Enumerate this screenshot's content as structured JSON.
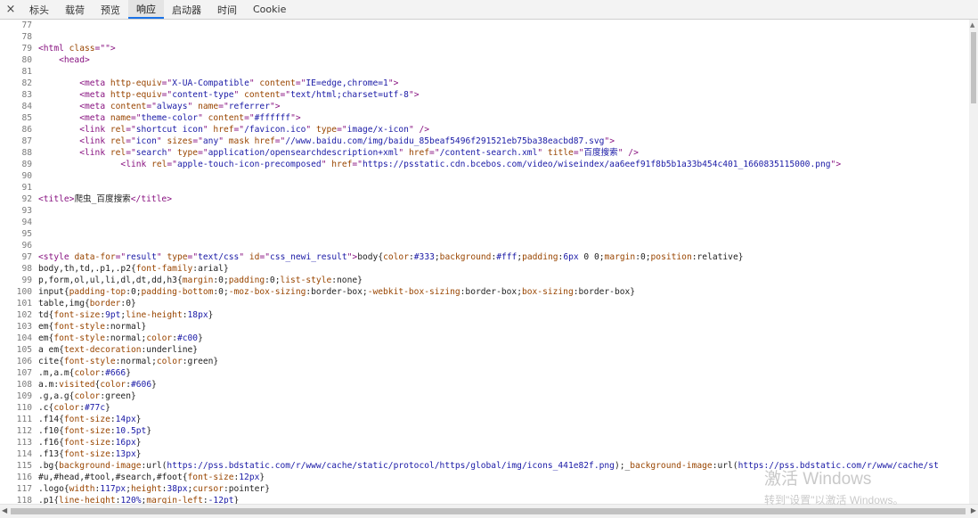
{
  "tabs": {
    "close": "×",
    "items": [
      "标头",
      "载荷",
      "预览",
      "响应",
      "启动器",
      "时间",
      "Cookie"
    ],
    "active_index": 3
  },
  "source_lines": [
    {
      "n": "77",
      "segs": []
    },
    {
      "n": "78",
      "segs": []
    },
    {
      "n": "79",
      "segs": [
        [
          "tg",
          "<html "
        ],
        [
          "at",
          "class"
        ],
        [
          "tg",
          "=\""
        ],
        [
          "av",
          ""
        ],
        [
          "tg",
          "\">"
        ]
      ]
    },
    {
      "n": "80",
      "segs": [
        [
          "tx",
          "    "
        ],
        [
          "tg",
          "<head>"
        ]
      ]
    },
    {
      "n": "81",
      "segs": []
    },
    {
      "n": "82",
      "segs": [
        [
          "tx",
          "        "
        ],
        [
          "tg",
          "<meta "
        ],
        [
          "at",
          "http-equiv"
        ],
        [
          "tg",
          "=\""
        ],
        [
          "av",
          "X-UA-Compatible"
        ],
        [
          "tg",
          "\" "
        ],
        [
          "at",
          "content"
        ],
        [
          "tg",
          "=\""
        ],
        [
          "av",
          "IE=edge,chrome=1"
        ],
        [
          "tg",
          "\">"
        ]
      ]
    },
    {
      "n": "83",
      "segs": [
        [
          "tx",
          "        "
        ],
        [
          "tg",
          "<meta "
        ],
        [
          "at",
          "http-equiv"
        ],
        [
          "tg",
          "=\""
        ],
        [
          "av",
          "content-type"
        ],
        [
          "tg",
          "\" "
        ],
        [
          "at",
          "content"
        ],
        [
          "tg",
          "=\""
        ],
        [
          "av",
          "text/html;charset=utf-8"
        ],
        [
          "tg",
          "\">"
        ]
      ]
    },
    {
      "n": "84",
      "segs": [
        [
          "tx",
          "        "
        ],
        [
          "tg",
          "<meta "
        ],
        [
          "at",
          "content"
        ],
        [
          "tg",
          "=\""
        ],
        [
          "av",
          "always"
        ],
        [
          "tg",
          "\" "
        ],
        [
          "at",
          "name"
        ],
        [
          "tg",
          "=\""
        ],
        [
          "av",
          "referrer"
        ],
        [
          "tg",
          "\">"
        ]
      ]
    },
    {
      "n": "85",
      "segs": [
        [
          "tx",
          "        "
        ],
        [
          "tg",
          "<meta "
        ],
        [
          "at",
          "name"
        ],
        [
          "tg",
          "=\""
        ],
        [
          "av",
          "theme-color"
        ],
        [
          "tg",
          "\" "
        ],
        [
          "at",
          "content"
        ],
        [
          "tg",
          "=\""
        ],
        [
          "av",
          "#ffffff"
        ],
        [
          "tg",
          "\">"
        ]
      ]
    },
    {
      "n": "86",
      "segs": [
        [
          "tx",
          "        "
        ],
        [
          "tg",
          "<link "
        ],
        [
          "at",
          "rel"
        ],
        [
          "tg",
          "=\""
        ],
        [
          "av",
          "shortcut icon"
        ],
        [
          "tg",
          "\" "
        ],
        [
          "at",
          "href"
        ],
        [
          "tg",
          "=\""
        ],
        [
          "av",
          "/favicon.ico"
        ],
        [
          "tg",
          "\" "
        ],
        [
          "at",
          "type"
        ],
        [
          "tg",
          "=\""
        ],
        [
          "av",
          "image/x-icon"
        ],
        [
          "tg",
          "\" />"
        ]
      ]
    },
    {
      "n": "87",
      "segs": [
        [
          "tx",
          "        "
        ],
        [
          "tg",
          "<link "
        ],
        [
          "at",
          "rel"
        ],
        [
          "tg",
          "=\""
        ],
        [
          "av",
          "icon"
        ],
        [
          "tg",
          "\" "
        ],
        [
          "at",
          "sizes"
        ],
        [
          "tg",
          "=\""
        ],
        [
          "av",
          "any"
        ],
        [
          "tg",
          "\" "
        ],
        [
          "at",
          "mask href"
        ],
        [
          "tg",
          "=\""
        ],
        [
          "av",
          "//www.baidu.com/img/baidu_85beaf5496f291521eb75ba38eacbd87.svg"
        ],
        [
          "tg",
          "\">"
        ]
      ]
    },
    {
      "n": "88",
      "segs": [
        [
          "tx",
          "        "
        ],
        [
          "tg",
          "<link "
        ],
        [
          "at",
          "rel"
        ],
        [
          "tg",
          "=\""
        ],
        [
          "av",
          "search"
        ],
        [
          "tg",
          "\" "
        ],
        [
          "at",
          "type"
        ],
        [
          "tg",
          "=\""
        ],
        [
          "av",
          "application/opensearchdescription+xml"
        ],
        [
          "tg",
          "\" "
        ],
        [
          "at",
          "href"
        ],
        [
          "tg",
          "=\""
        ],
        [
          "av",
          "/content-search.xml"
        ],
        [
          "tg",
          "\" "
        ],
        [
          "at",
          "title"
        ],
        [
          "tg",
          "=\""
        ],
        [
          "av",
          "百度搜索"
        ],
        [
          "tg",
          "\" />"
        ]
      ]
    },
    {
      "n": "89",
      "segs": [
        [
          "tx",
          "                "
        ],
        [
          "tg",
          "<link "
        ],
        [
          "at",
          "rel"
        ],
        [
          "tg",
          "=\""
        ],
        [
          "av",
          "apple-touch-icon-precomposed"
        ],
        [
          "tg",
          "\" "
        ],
        [
          "at",
          "href"
        ],
        [
          "tg",
          "=\""
        ],
        [
          "av",
          "https://psstatic.cdn.bcebos.com/video/wiseindex/aa6eef91f8b5b1a33b454c401_1660835115000.png"
        ],
        [
          "tg",
          "\">"
        ]
      ]
    },
    {
      "n": "90",
      "segs": []
    },
    {
      "n": "91",
      "segs": []
    },
    {
      "n": "92",
      "segs": [
        [
          "tg",
          "<title>"
        ],
        [
          "tx",
          "爬虫_百度搜索"
        ],
        [
          "tg",
          "</title>"
        ]
      ]
    },
    {
      "n": "93",
      "segs": []
    },
    {
      "n": "94",
      "segs": []
    },
    {
      "n": "95",
      "segs": []
    },
    {
      "n": "96",
      "segs": []
    },
    {
      "n": "97",
      "segs": [
        [
          "tg",
          "<style "
        ],
        [
          "at",
          "data-for"
        ],
        [
          "tg",
          "=\""
        ],
        [
          "av",
          "result"
        ],
        [
          "tg",
          "\" "
        ],
        [
          "at",
          "type"
        ],
        [
          "tg",
          "=\""
        ],
        [
          "av",
          "text/css"
        ],
        [
          "tg",
          "\" "
        ],
        [
          "at",
          "id"
        ],
        [
          "tg",
          "=\""
        ],
        [
          "av",
          "css_newi_result"
        ],
        [
          "tg",
          "\">"
        ],
        [
          "tx",
          "body{"
        ],
        [
          "at",
          "color"
        ],
        [
          "tx",
          ":"
        ],
        [
          "av",
          "#333"
        ],
        [
          "tx",
          ";"
        ],
        [
          "at",
          "background"
        ],
        [
          "tx",
          ":"
        ],
        [
          "av",
          "#fff"
        ],
        [
          "tx",
          ";"
        ],
        [
          "at",
          "padding"
        ],
        [
          "tx",
          ":"
        ],
        [
          "av",
          "6px"
        ],
        [
          "tx",
          " 0 0;"
        ],
        [
          "at",
          "margin"
        ],
        [
          "tx",
          ":0;"
        ],
        [
          "at",
          "position"
        ],
        [
          "tx",
          ":relative}"
        ]
      ]
    },
    {
      "n": "98",
      "segs": [
        [
          "tx",
          "body,th,td,.p1,.p2{"
        ],
        [
          "at",
          "font-family"
        ],
        [
          "tx",
          ":arial}"
        ]
      ]
    },
    {
      "n": "99",
      "segs": [
        [
          "tx",
          "p,form,ol,ul,li,dl,dt,dd,h3{"
        ],
        [
          "at",
          "margin"
        ],
        [
          "tx",
          ":0;"
        ],
        [
          "at",
          "padding"
        ],
        [
          "tx",
          ":0;"
        ],
        [
          "at",
          "list-style"
        ],
        [
          "tx",
          ":none}"
        ]
      ]
    },
    {
      "n": "100",
      "segs": [
        [
          "tx",
          "input{"
        ],
        [
          "at",
          "padding-top"
        ],
        [
          "tx",
          ":0;"
        ],
        [
          "at",
          "padding-bottom"
        ],
        [
          "tx",
          ":0;"
        ],
        [
          "at",
          "-moz-box-sizing"
        ],
        [
          "tx",
          ":border-box;"
        ],
        [
          "at",
          "-webkit-box-sizing"
        ],
        [
          "tx",
          ":border-box;"
        ],
        [
          "at",
          "box-sizing"
        ],
        [
          "tx",
          ":border-box}"
        ]
      ]
    },
    {
      "n": "101",
      "segs": [
        [
          "tx",
          "table,img{"
        ],
        [
          "at",
          "border"
        ],
        [
          "tx",
          ":0}"
        ]
      ]
    },
    {
      "n": "102",
      "segs": [
        [
          "tx",
          "td{"
        ],
        [
          "at",
          "font-size"
        ],
        [
          "tx",
          ":"
        ],
        [
          "av",
          "9pt"
        ],
        [
          "tx",
          ";"
        ],
        [
          "at",
          "line-height"
        ],
        [
          "tx",
          ":"
        ],
        [
          "av",
          "18px"
        ],
        [
          "tx",
          "}"
        ]
      ]
    },
    {
      "n": "103",
      "segs": [
        [
          "tx",
          "em{"
        ],
        [
          "at",
          "font-style"
        ],
        [
          "tx",
          ":normal}"
        ]
      ]
    },
    {
      "n": "104",
      "segs": [
        [
          "tx",
          "em{"
        ],
        [
          "at",
          "font-style"
        ],
        [
          "tx",
          ":normal;"
        ],
        [
          "at",
          "color"
        ],
        [
          "tx",
          ":"
        ],
        [
          "av",
          "#c00"
        ],
        [
          "tx",
          "}"
        ]
      ]
    },
    {
      "n": "105",
      "segs": [
        [
          "tx",
          "a em{"
        ],
        [
          "at",
          "text-decoration"
        ],
        [
          "tx",
          ":underline}"
        ]
      ]
    },
    {
      "n": "106",
      "segs": [
        [
          "tx",
          "cite{"
        ],
        [
          "at",
          "font-style"
        ],
        [
          "tx",
          ":normal;"
        ],
        [
          "at",
          "color"
        ],
        [
          "tx",
          ":green}"
        ]
      ]
    },
    {
      "n": "107",
      "segs": [
        [
          "tx",
          ".m,a.m{"
        ],
        [
          "at",
          "color"
        ],
        [
          "tx",
          ":"
        ],
        [
          "av",
          "#666"
        ],
        [
          "tx",
          "}"
        ]
      ]
    },
    {
      "n": "108",
      "segs": [
        [
          "tx",
          "a.m:"
        ],
        [
          "at",
          "visited"
        ],
        [
          "tx",
          "{"
        ],
        [
          "at",
          "color"
        ],
        [
          "tx",
          ":"
        ],
        [
          "av",
          "#606"
        ],
        [
          "tx",
          "}"
        ]
      ]
    },
    {
      "n": "109",
      "segs": [
        [
          "tx",
          ".g,a.g{"
        ],
        [
          "at",
          "color"
        ],
        [
          "tx",
          ":green}"
        ]
      ]
    },
    {
      "n": "110",
      "segs": [
        [
          "tx",
          ".c{"
        ],
        [
          "at",
          "color"
        ],
        [
          "tx",
          ":"
        ],
        [
          "av",
          "#77c"
        ],
        [
          "tx",
          "}"
        ]
      ]
    },
    {
      "n": "111",
      "segs": [
        [
          "tx",
          ".f14{"
        ],
        [
          "at",
          "font-size"
        ],
        [
          "tx",
          ":"
        ],
        [
          "av",
          "14px"
        ],
        [
          "tx",
          "}"
        ]
      ]
    },
    {
      "n": "112",
      "segs": [
        [
          "tx",
          ".f10{"
        ],
        [
          "at",
          "font-size"
        ],
        [
          "tx",
          ":"
        ],
        [
          "av",
          "10.5pt"
        ],
        [
          "tx",
          "}"
        ]
      ]
    },
    {
      "n": "113",
      "segs": [
        [
          "tx",
          ".f16{"
        ],
        [
          "at",
          "font-size"
        ],
        [
          "tx",
          ":"
        ],
        [
          "av",
          "16px"
        ],
        [
          "tx",
          "}"
        ]
      ]
    },
    {
      "n": "114",
      "segs": [
        [
          "tx",
          ".f13{"
        ],
        [
          "at",
          "font-size"
        ],
        [
          "tx",
          ":"
        ],
        [
          "av",
          "13px"
        ],
        [
          "tx",
          "}"
        ]
      ]
    },
    {
      "n": "115",
      "segs": [
        [
          "tx",
          ".bg{"
        ],
        [
          "at",
          "background-image"
        ],
        [
          "tx",
          ":url("
        ],
        [
          "av",
          "https://pss.bdstatic.com/r/www/cache/static/protocol/https/global/img/icons_441e82f.png"
        ],
        [
          "tx",
          ");_"
        ],
        [
          "at",
          "background-image"
        ],
        [
          "tx",
          ":url("
        ],
        [
          "av",
          "https://pss.bdstatic.com/r/www/cache/st"
        ]
      ]
    },
    {
      "n": "116",
      "segs": [
        [
          "tx",
          "#u,#head,#tool,#search,#foot{"
        ],
        [
          "at",
          "font-size"
        ],
        [
          "tx",
          ":"
        ],
        [
          "av",
          "12px"
        ],
        [
          "tx",
          "}"
        ]
      ]
    },
    {
      "n": "117",
      "segs": [
        [
          "tx",
          ".logo{"
        ],
        [
          "at",
          "width"
        ],
        [
          "tx",
          ":"
        ],
        [
          "av",
          "117px"
        ],
        [
          "tx",
          ";"
        ],
        [
          "at",
          "height"
        ],
        [
          "tx",
          ":"
        ],
        [
          "av",
          "38px"
        ],
        [
          "tx",
          ";"
        ],
        [
          "at",
          "cursor"
        ],
        [
          "tx",
          ":pointer}"
        ]
      ]
    },
    {
      "n": "118",
      "segs": [
        [
          "tx",
          ".p1{"
        ],
        [
          "at",
          "line-height"
        ],
        [
          "tx",
          ":"
        ],
        [
          "av",
          "120%"
        ],
        [
          "tx",
          ";"
        ],
        [
          "at",
          "margin-left"
        ],
        [
          "tx",
          ":"
        ],
        [
          "av",
          "-12pt"
        ],
        [
          "tx",
          "}"
        ]
      ]
    }
  ],
  "scrollbar": {
    "up": "▲",
    "left": "◀",
    "right": "▶"
  },
  "activation": {
    "title": "激活 Windows",
    "subtitle": "转到\"设置\"以激活 Windows。"
  }
}
